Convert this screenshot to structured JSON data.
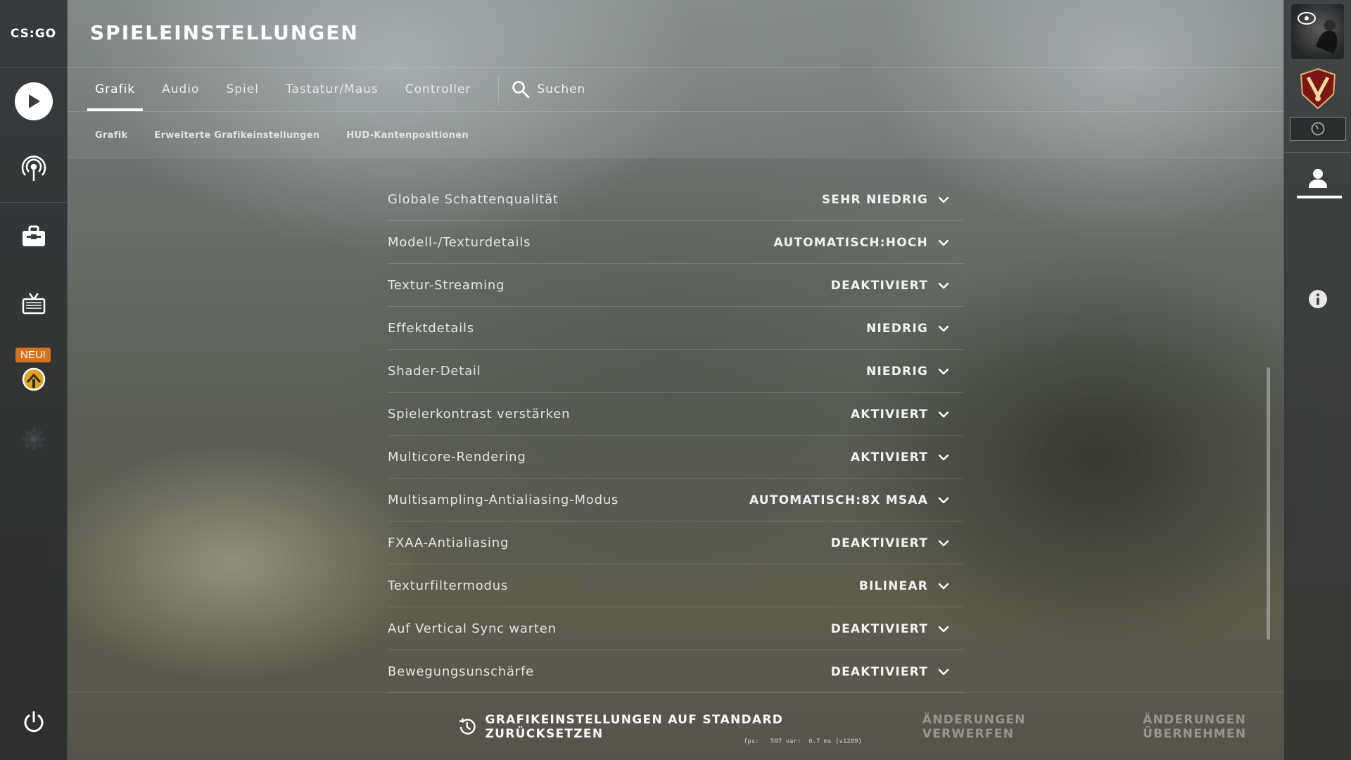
{
  "app": {
    "logo_text": "CS:GO"
  },
  "sidebar_left": {
    "new_badge": "NEU!",
    "items": [
      {
        "name": "play-icon"
      },
      {
        "name": "broadcast-icon"
      },
      {
        "name": "inventory-icon"
      },
      {
        "name": "watch-tv-icon"
      },
      {
        "name": "operation-icon"
      },
      {
        "name": "settings-gear-icon"
      },
      {
        "name": "power-icon"
      }
    ]
  },
  "header": {
    "title": "SPIELEINSTELLUNGEN",
    "tabs": [
      {
        "label": "Grafik",
        "active": true
      },
      {
        "label": "Audio"
      },
      {
        "label": "Spiel"
      },
      {
        "label": "Tastatur/Maus"
      },
      {
        "label": "Controller"
      }
    ],
    "search_label": "Suchen",
    "subtabs": [
      {
        "label": "Grafik"
      },
      {
        "label": "Erweiterte Grafikeinstellungen"
      },
      {
        "label": "HUD-Kantenpositionen"
      }
    ]
  },
  "settings": [
    {
      "label": "Globale Schattenqualität",
      "value": "SEHR NIEDRIG"
    },
    {
      "label": "Modell-/Texturdetails",
      "value": "AUTOMATISCH:HOCH"
    },
    {
      "label": "Textur-Streaming",
      "value": "DEAKTIVIERT"
    },
    {
      "label": "Effektdetails",
      "value": "NIEDRIG"
    },
    {
      "label": "Shader-Detail",
      "value": "NIEDRIG"
    },
    {
      "label": "Spielerkontrast verstärken",
      "value": "AKTIVIERT"
    },
    {
      "label": "Multicore-Rendering",
      "value": "AKTIVIERT"
    },
    {
      "label": "Multisampling-Antialiasing-Modus",
      "value": "AUTOMATISCH:8X MSAA"
    },
    {
      "label": "FXAA-Antialiasing",
      "value": "DEAKTIVIERT"
    },
    {
      "label": "Texturfiltermodus",
      "value": "BILINEAR"
    },
    {
      "label": "Auf Vertical Sync warten",
      "value": "DEAKTIVIERT"
    },
    {
      "label": "Bewegungsunschärfe",
      "value": "DEAKTIVIERT"
    }
  ],
  "footer": {
    "reset_label": "GRAFIKEINSTELLUNGEN AUF STANDARD ZURÜCKSETZEN",
    "discard_label": "ÄNDERUNGEN VERWERFEN",
    "apply_label": "ÄNDERUNGEN ÜBERNEHMEN",
    "fps_text": "fps:   597 var:  0.7 ms (v1289)"
  },
  "colors": {
    "new_badge": "#d4731f",
    "accent": "#ffffff"
  }
}
